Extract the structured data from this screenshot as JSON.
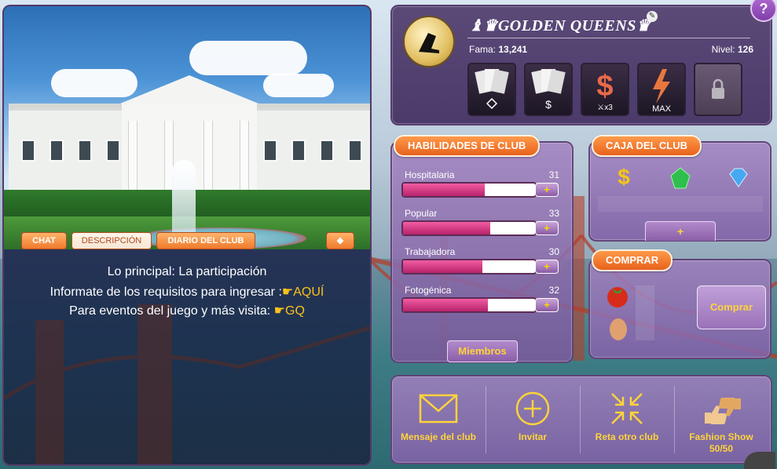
{
  "left": {
    "tabs": [
      {
        "label": "CHAT"
      },
      {
        "label": "DESCRIPCIÓN"
      },
      {
        "label": "DIARIO DEL CLUB"
      }
    ],
    "description": {
      "line1": "Lo principal: La participación",
      "line2_text": "Informate de los requisitos para ingresar :",
      "line2_link": "☛AQUÍ",
      "line3_text": "Para eventos del juego y más visita: ",
      "line3_link": "☛GQ"
    }
  },
  "club": {
    "name": "♝♛GOLDEN QUEENS♛",
    "fame_label": "Fama:",
    "fame_value": "13,241",
    "level_label": "Nivel:",
    "level_value": "126",
    "perks": [
      {
        "icon": "cards-diamond-icon",
        "sub": "♦"
      },
      {
        "icon": "cards-dollar-icon",
        "sub": "$"
      },
      {
        "icon": "dollar-swords-icon",
        "sub": "x3"
      },
      {
        "icon": "lightning-max-icon",
        "sub": "MAX"
      },
      {
        "icon": "lock-icon",
        "sub": ""
      }
    ]
  },
  "skills": {
    "title": "HABILIDADES DE CLUB",
    "items": [
      {
        "name": "Hospitalaria",
        "value": "31",
        "level": 0.62
      },
      {
        "name": "Popular",
        "value": "33",
        "level": 0.66
      },
      {
        "name": "Trabajadora",
        "value": "30",
        "level": 0.6
      },
      {
        "name": "Fotogénica",
        "value": "32",
        "level": 0.64
      }
    ],
    "plus_label": "+",
    "members_label": "Miembros"
  },
  "box": {
    "title": "CAJA DEL CLUB",
    "plus_label": "+"
  },
  "buy": {
    "title": "COMPRAR",
    "button_label": "Comprar"
  },
  "actions": [
    {
      "label": "Mensaje del club",
      "icon": "envelope-icon"
    },
    {
      "label": "Invitar",
      "icon": "plus-circle-icon"
    },
    {
      "label": "Reta otro club",
      "icon": "arrows-inward-icon"
    },
    {
      "label": "Fashion Show",
      "label2": "50/50",
      "icon": "thumbs-icon"
    }
  ],
  "colors": {
    "accent_orange": "#f07a2c",
    "link_gold": "#ffc21a",
    "panel_purple": "#8b5fa8"
  }
}
